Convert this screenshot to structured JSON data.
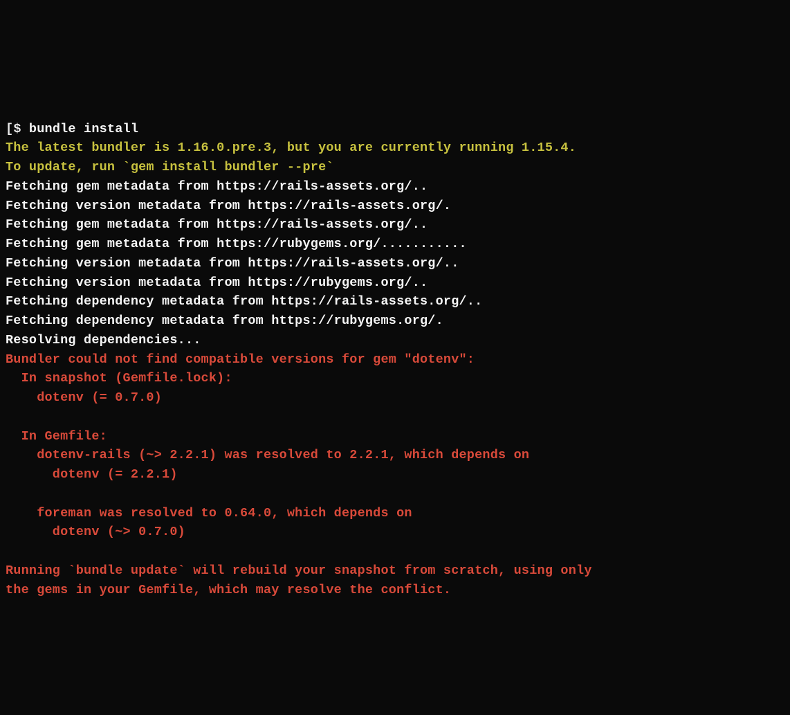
{
  "prompt": {
    "bracket": "[",
    "dollar": "$ ",
    "command": "bundle install"
  },
  "lines": [
    {
      "cls": "yellow",
      "text": "The latest bundler is 1.16.0.pre.3, but you are currently running 1.15.4."
    },
    {
      "cls": "yellow",
      "text": "To update, run `gem install bundler --pre`"
    },
    {
      "cls": "white",
      "text": "Fetching gem metadata from https://rails-assets.org/.."
    },
    {
      "cls": "white",
      "text": "Fetching version metadata from https://rails-assets.org/."
    },
    {
      "cls": "white",
      "text": "Fetching gem metadata from https://rails-assets.org/.."
    },
    {
      "cls": "white",
      "text": "Fetching gem metadata from https://rubygems.org/..........."
    },
    {
      "cls": "white",
      "text": "Fetching version metadata from https://rails-assets.org/.."
    },
    {
      "cls": "white",
      "text": "Fetching version metadata from https://rubygems.org/.."
    },
    {
      "cls": "white",
      "text": "Fetching dependency metadata from https://rails-assets.org/.."
    },
    {
      "cls": "white",
      "text": "Fetching dependency metadata from https://rubygems.org/."
    },
    {
      "cls": "white",
      "text": "Resolving dependencies..."
    },
    {
      "cls": "red",
      "text": "Bundler could not find compatible versions for gem \"dotenv\":"
    },
    {
      "cls": "red",
      "text": "  In snapshot (Gemfile.lock):"
    },
    {
      "cls": "red",
      "text": "    dotenv (= 0.7.0)"
    },
    {
      "cls": "red",
      "text": ""
    },
    {
      "cls": "red",
      "text": "  In Gemfile:"
    },
    {
      "cls": "red",
      "text": "    dotenv-rails (~> 2.2.1) was resolved to 2.2.1, which depends on"
    },
    {
      "cls": "red",
      "text": "      dotenv (= 2.2.1)"
    },
    {
      "cls": "red",
      "text": ""
    },
    {
      "cls": "red",
      "text": "    foreman was resolved to 0.64.0, which depends on"
    },
    {
      "cls": "red",
      "text": "      dotenv (~> 0.7.0)"
    },
    {
      "cls": "red",
      "text": ""
    },
    {
      "cls": "red",
      "text": "Running `bundle update` will rebuild your snapshot from scratch, using only"
    },
    {
      "cls": "red",
      "text": "the gems in your Gemfile, which may resolve the conflict."
    }
  ]
}
